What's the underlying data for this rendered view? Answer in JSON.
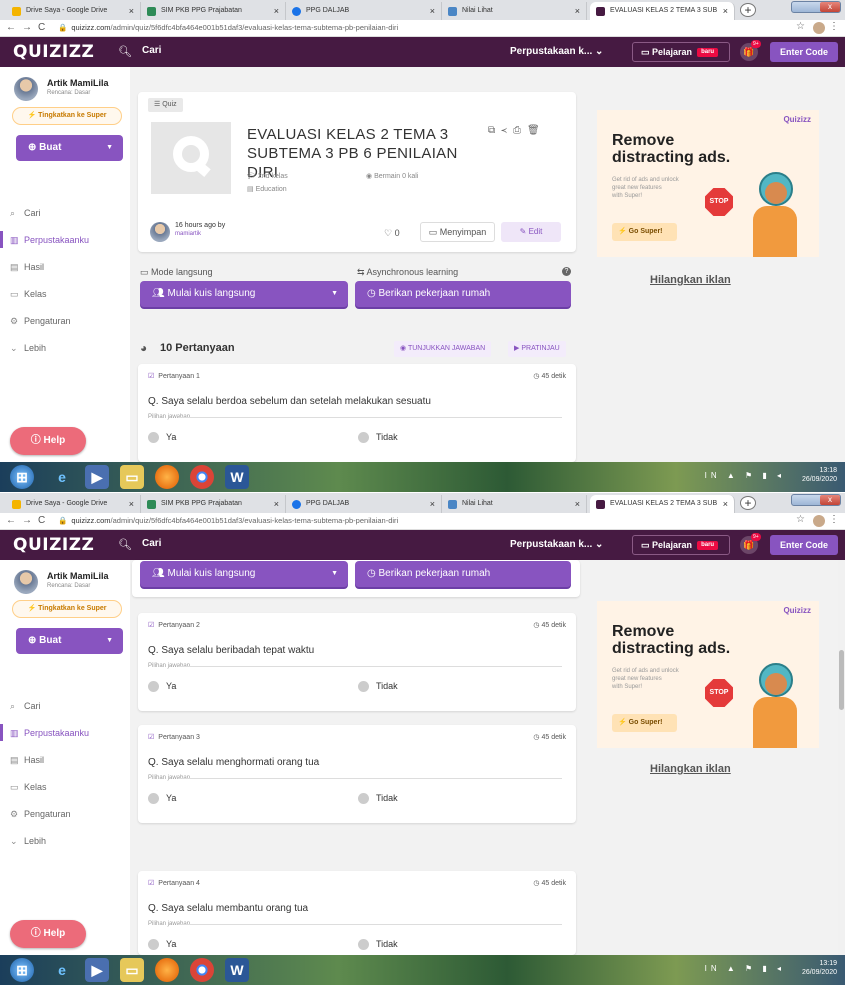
{
  "browser": {
    "tabs": [
      "Drive Saya - Google Drive",
      "SIM PKB PPG Prajabatan",
      "PPG DALJAB",
      "Nilai Lihat",
      "EVALUASI KELAS 2 TEMA 3 SUB"
    ],
    "url_host": "quizizz.com",
    "url_path": "/admin/quiz/5f6dfc4bfa464e001b51daf3/evaluasi-kelas-tema-subtema-pb-penilaian-diri",
    "tab_favicon_colors": [
      "#f4b400",
      "#2e8b57",
      "#1a73e8",
      "#4a86c5",
      "#461a42"
    ]
  },
  "nav": {
    "logo": "QUIZIZZ",
    "search": "Cari",
    "library": "Perpustakaan k...",
    "pelajaran": "Pelajaran",
    "baru": "baru",
    "gift_badge": "9+",
    "enter_code": "Enter Code"
  },
  "sidebar": {
    "user": "Artik MamiLila",
    "plan": "Rencana: Dasar",
    "upgrade": "Tingkatkan ke Super",
    "create": "Buat",
    "items": [
      "Cari",
      "Perpustakaanku",
      "Hasil",
      "Kelas",
      "Pengaturan",
      "Lebih"
    ],
    "help": "Help"
  },
  "quiz": {
    "badge": "Quiz",
    "title": "EVALUASI KELAS 2 TEMA 3 SUBTEMA 3 PB 6 PENILAIAN DIRI",
    "grade": "2nd kelas",
    "played": "Bermain 0 kali",
    "subject": "Education",
    "ago": "16 hours ago by",
    "author": "mamiartik",
    "likes": "0",
    "save": "Menyimpan",
    "edit": "Edit"
  },
  "modes": {
    "live_label": "Mode langsung",
    "async_label": "Asynchronous learning",
    "live_button": "Mulai kuis langsung",
    "homework_button": "Berikan pekerjaan rumah"
  },
  "questions_header": {
    "count": "10 Pertanyaan",
    "show_answers": "TUNJUKKAN JAWABAN",
    "preview": "PRATINJAU"
  },
  "questions": [
    {
      "num": "Pertanyaan 1",
      "time": "45 detik",
      "text": "Q. Saya selalu berdoa sebelum dan setelah melakukan sesuatu",
      "choices_label": "Pilihan jawaban",
      "opt1": "Ya",
      "opt2": "Tidak"
    },
    {
      "num": "Pertanyaan 2",
      "time": "45 detik",
      "text": "Q. Saya selalu beribadah tepat waktu",
      "choices_label": "Pilihan jawaban",
      "opt1": "Ya",
      "opt2": "Tidak"
    },
    {
      "num": "Pertanyaan 3",
      "time": "45 detik",
      "text": "Q. Saya selalu menghormati orang tua",
      "choices_label": "Pilihan jawaban",
      "opt1": "Ya",
      "opt2": "Tidak"
    },
    {
      "num": "Pertanyaan 4",
      "time": "45 detik",
      "text": "Q. Saya selalu membantu orang tua",
      "choices_label": "Pilihan jawaban",
      "opt1": "Ya",
      "opt2": "Tidak"
    }
  ],
  "ad": {
    "brand": "Quizizz",
    "headline1": "Remove",
    "headline2": "distracting ads.",
    "sub1": "Get rid of ads and unlock",
    "sub2": "great new features",
    "sub3": "with Super!",
    "stop": "STOP ADS",
    "go": "Go Super!",
    "remove_link": "Hilangkan iklan"
  },
  "taskbar": {
    "lang": "IN",
    "time1": "13:18",
    "time2": "13:19",
    "date": "26/09/2020"
  },
  "colors": {
    "brand": "#461a42",
    "accent": "#8854c0",
    "help": "#ec6b7a"
  }
}
